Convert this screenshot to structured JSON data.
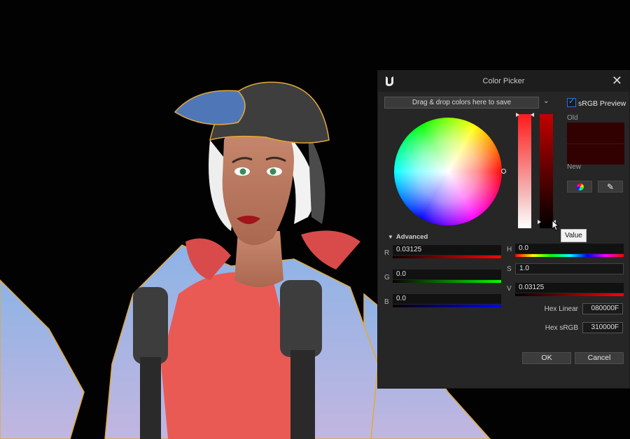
{
  "dialog": {
    "title": "Color Picker",
    "close_icon": "✕",
    "drop_bar": "Drag & drop colors here to save",
    "dropdown_icon": "chevron-down-icon",
    "srgb_preview_label": "sRGB Preview",
    "srgb_preview_checked": true,
    "old_label": "Old",
    "new_label": "New",
    "old_color": "#310000",
    "new_color": "#310000",
    "tooltip": "Value",
    "advanced_label": "Advanced",
    "rgb": {
      "r_label": "R",
      "r_value": "0.03125",
      "g_label": "G",
      "g_value": "0.0",
      "b_label": "B",
      "b_value": "0.0"
    },
    "hsv": {
      "h_label": "H",
      "h_value": "0.0",
      "s_label": "S",
      "s_value": "1.0",
      "v_label": "V",
      "v_value": "0.03125"
    },
    "hex_linear_label": "Hex Linear",
    "hex_linear_value": "080000F",
    "hex_srgb_label": "Hex sRGB",
    "hex_srgb_value": "310000F",
    "ok_label": "OK",
    "cancel_label": "Cancel"
  }
}
